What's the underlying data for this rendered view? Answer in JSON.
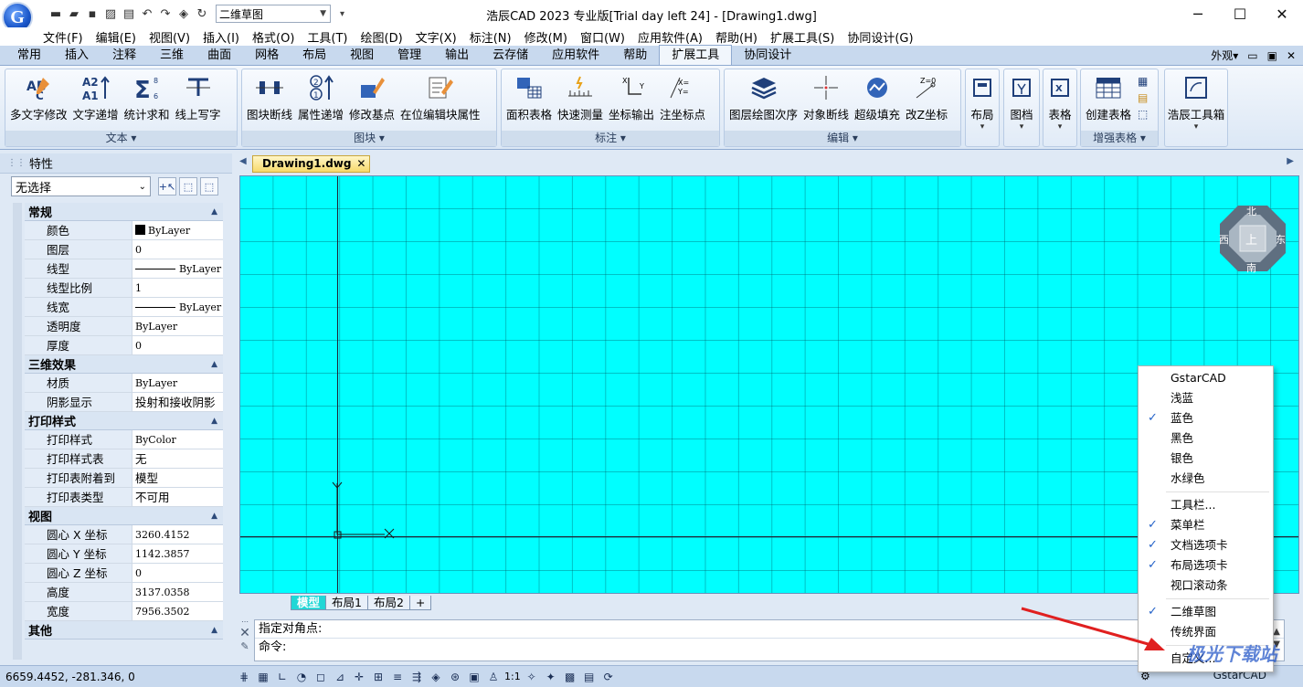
{
  "window": {
    "title": "浩辰CAD 2023 专业版[Trial day left 24] - [Drawing1.dwg]",
    "workspace": "二维草图",
    "logo_letter": "G"
  },
  "menu": [
    "文件(F)",
    "编辑(E)",
    "视图(V)",
    "插入(I)",
    "格式(O)",
    "工具(T)",
    "绘图(D)",
    "文字(X)",
    "标注(N)",
    "修改(M)",
    "窗口(W)",
    "应用软件(A)",
    "帮助(H)",
    "扩展工具(S)",
    "协同设计(G)"
  ],
  "ribbon_tabs": [
    "常用",
    "插入",
    "注释",
    "三维",
    "曲面",
    "网格",
    "布局",
    "视图",
    "管理",
    "输出",
    "云存储",
    "应用软件",
    "帮助",
    "扩展工具",
    "协同设计"
  ],
  "ribbon_active": "扩展工具",
  "ribbon_right": {
    "appearance": "外观▾"
  },
  "groups": {
    "text": {
      "title": "文本",
      "buttons": [
        "多文字修改",
        "文字递增",
        "统计求和",
        "线上写字"
      ]
    },
    "block": {
      "title": "图块",
      "buttons": [
        "图块断线",
        "属性递增",
        "修改基点",
        "在位编辑块属性"
      ]
    },
    "dim": {
      "title": "标注",
      "buttons": [
        "面积表格",
        "快速测量",
        "坐标输出",
        "注坐标点"
      ]
    },
    "edit": {
      "title": "编辑",
      "buttons": [
        "图层绘图次序",
        "对象断线",
        "超级填充",
        "改Z坐标"
      ]
    },
    "small": {
      "layout": "布局",
      "archive": "图档",
      "table": "表格"
    },
    "table_enh": {
      "title": "增强表格",
      "create": "创建表格"
    },
    "toolbox": {
      "label": "浩辰工具箱"
    }
  },
  "properties": {
    "title": "特性",
    "selection": "无选择",
    "categories": [
      {
        "name": "常规",
        "rows": [
          {
            "name": "颜色",
            "value": "ByLayer",
            "kind": "swatch"
          },
          {
            "name": "图层",
            "value": "0"
          },
          {
            "name": "线型",
            "value": "ByLayer",
            "kind": "line"
          },
          {
            "name": "线型比例",
            "value": "1"
          },
          {
            "name": "线宽",
            "value": "ByLayer",
            "kind": "line"
          },
          {
            "name": "透明度",
            "value": "ByLayer"
          },
          {
            "name": "厚度",
            "value": "0"
          }
        ]
      },
      {
        "name": "三维效果",
        "rows": [
          {
            "name": "材质",
            "value": "ByLayer"
          },
          {
            "name": "阴影显示",
            "value": "投射和接收阴影",
            "kind": "cjk"
          }
        ]
      },
      {
        "name": "打印样式",
        "rows": [
          {
            "name": "打印样式",
            "value": "ByColor"
          },
          {
            "name": "打印样式表",
            "value": "无",
            "kind": "cjk"
          },
          {
            "name": "打印表附着到",
            "value": "模型",
            "kind": "cjk"
          },
          {
            "name": "打印表类型",
            "value": "不可用",
            "kind": "cjk"
          }
        ]
      },
      {
        "name": "视图",
        "rows": [
          {
            "name": "圆心 X 坐标",
            "value": "3260.4152"
          },
          {
            "name": "圆心 Y 坐标",
            "value": "1142.3857"
          },
          {
            "name": "圆心 Z 坐标",
            "value": "0"
          },
          {
            "name": "高度",
            "value": "3137.0358"
          },
          {
            "name": "宽度",
            "value": "7956.3502"
          }
        ]
      },
      {
        "name": "其他",
        "rows": []
      }
    ]
  },
  "document": {
    "tab": "Drawing1.dwg"
  },
  "compass": {
    "north": "北",
    "south": "南",
    "east": "东",
    "west": "西",
    "top": "上"
  },
  "axes": {
    "x": "X",
    "y": "Y"
  },
  "layout_tabs": [
    "模型",
    "布局1",
    "布局2",
    "+"
  ],
  "command": {
    "line1": "指定对角点:",
    "line2": "命令:"
  },
  "status": {
    "coords": "6659.4452, -281.346, 0",
    "scale": "1:1",
    "app": "GstarCAD"
  },
  "context_menu": [
    {
      "label": "GstarCAD",
      "checked": false
    },
    {
      "label": "浅蓝",
      "checked": false
    },
    {
      "label": "蓝色",
      "checked": true
    },
    {
      "label": "黑色",
      "checked": false
    },
    {
      "label": "银色",
      "checked": false
    },
    {
      "label": "水绿色",
      "checked": false
    },
    {
      "sep": true
    },
    {
      "label": "工具栏...",
      "checked": false
    },
    {
      "label": "菜单栏",
      "checked": true
    },
    {
      "label": "文档选项卡",
      "checked": true
    },
    {
      "label": "布局选项卡",
      "checked": true
    },
    {
      "label": "视口滚动条",
      "checked": false
    },
    {
      "sep": true
    },
    {
      "label": "二维草图",
      "checked": true
    },
    {
      "label": "传统界面",
      "checked": false
    },
    {
      "sep": true
    },
    {
      "label": "自定义...",
      "checked": false
    }
  ],
  "colors": {
    "canvas": "#00ffff",
    "accent": "#2563c9",
    "arrow": "#e02020"
  },
  "watermark": "极光下载站"
}
